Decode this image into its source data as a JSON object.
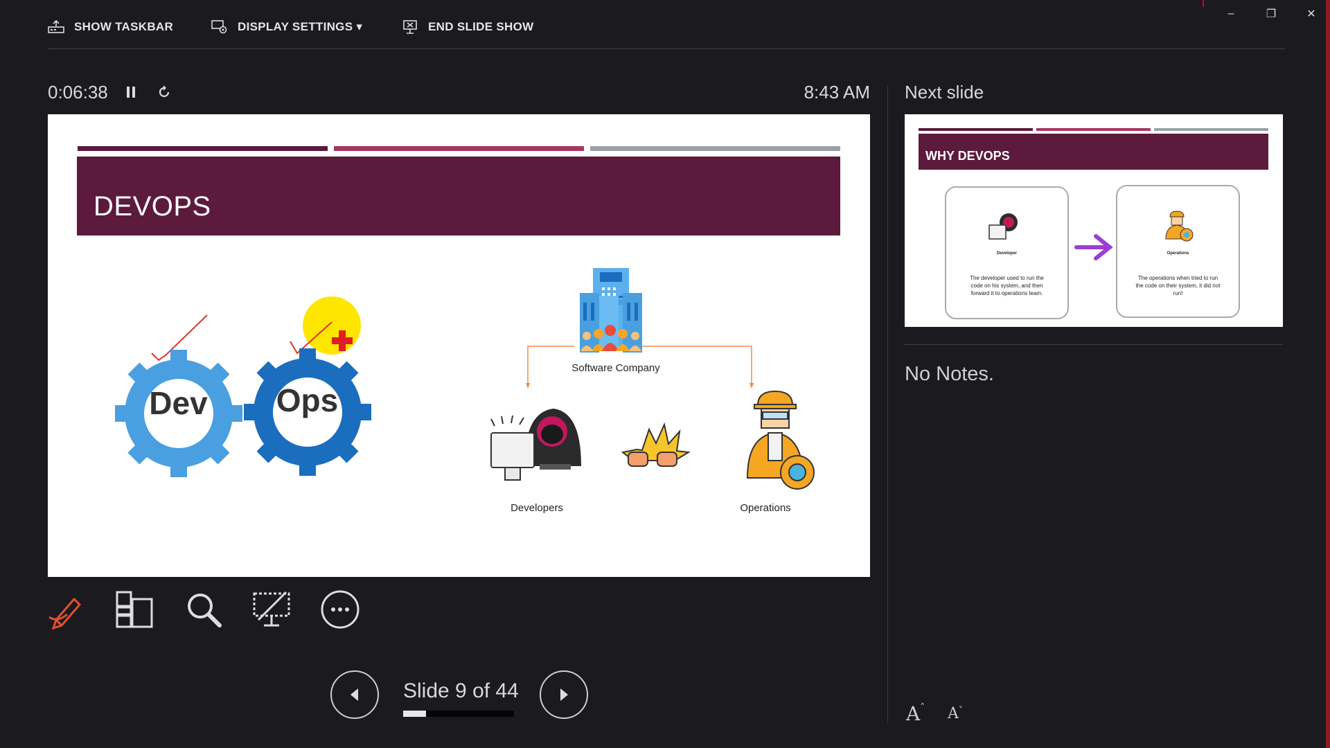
{
  "toolbar": {
    "show_taskbar": "SHOW TASKBAR",
    "display_settings": "DISPLAY SETTINGS ▾",
    "end_slide_show": "END SLIDE SHOW"
  },
  "window": {
    "minimize": "–",
    "restore": "❐",
    "close": "✕"
  },
  "timer": {
    "elapsed": "0:06:38",
    "clock": "8:43 AM"
  },
  "current_slide": {
    "title": "DEVOPS",
    "gear_left": "Dev",
    "gear_right": "Ops",
    "company_label": "Software Company",
    "developers_label": "Developers",
    "operations_label": "Operations"
  },
  "next_slide": {
    "label": "Next slide",
    "title": "WHY DEVOPS",
    "card_left_title": "Developer",
    "card_left_text": "The developer used to run the code on his system, and then forward it to operations team.",
    "card_right_title": "Operations",
    "card_right_text": "The operations when tried to run the code on their system, it did not run!"
  },
  "notes": {
    "text": "No Notes."
  },
  "navigation": {
    "slide_count": "Slide 9 of 44",
    "progress": 0.205
  },
  "colors": {
    "accent_header": "#5c1a3c",
    "bar_1": "#5c1a3c",
    "bar_2": "#a8355e",
    "bar_3": "#9aa0a6",
    "pen_tool": "#e0502f",
    "gear_light": "#4a9fe0",
    "gear_dark": "#1b6dbd"
  },
  "icons": [
    "taskbar-icon",
    "display-settings-icon",
    "end-show-icon",
    "pause-icon",
    "restart-icon",
    "pen-tool-icon",
    "see-all-slides-icon",
    "zoom-icon",
    "black-screen-icon",
    "more-options-icon",
    "previous-icon",
    "next-icon",
    "font-increase-icon",
    "font-decrease-icon"
  ]
}
